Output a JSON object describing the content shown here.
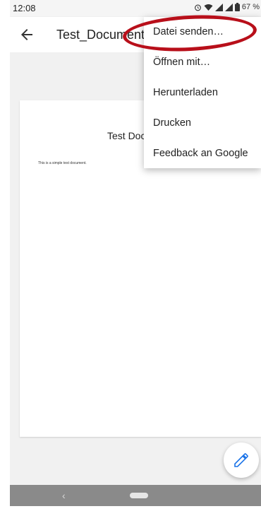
{
  "status_bar": {
    "time": "12:08",
    "battery": "67 %"
  },
  "app_bar": {
    "title": "Test_Document.pdf"
  },
  "document": {
    "heading": "Test Document",
    "body": "This is a simple test document."
  },
  "menu": {
    "items": [
      {
        "label": "Datei senden…"
      },
      {
        "label": "Öffnen mit…"
      },
      {
        "label": "Herunterladen"
      },
      {
        "label": "Drucken"
      },
      {
        "label": "Feedback an Google"
      }
    ]
  },
  "colors": {
    "highlight": "#b80f1a",
    "fab_icon": "#1a73e8",
    "nav_bar": "#8a8a8a"
  },
  "icons": {
    "back": "arrow-back-icon",
    "edit": "pencil-icon",
    "alarm": "alarm-icon",
    "wifi": "wifi-icon",
    "signal": "signal-icon",
    "battery": "battery-icon"
  }
}
